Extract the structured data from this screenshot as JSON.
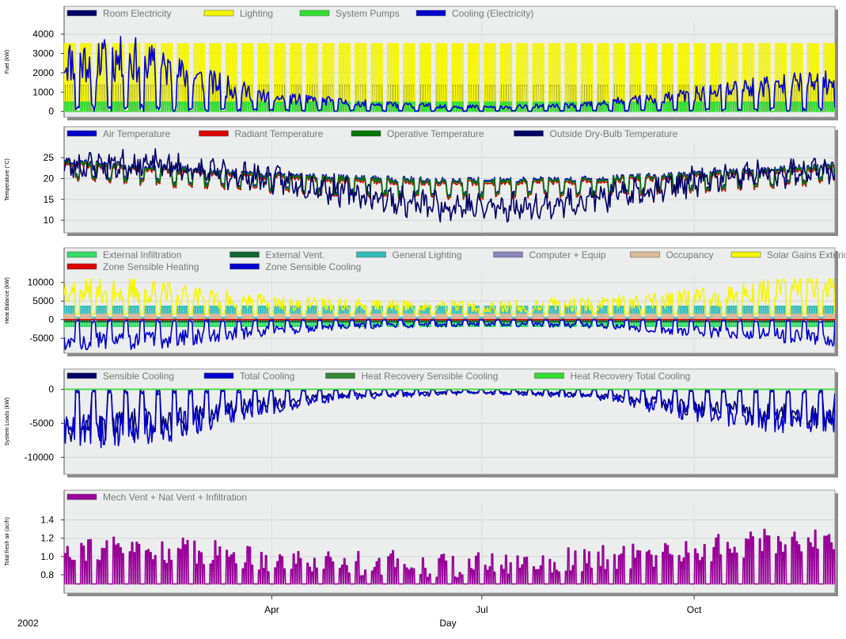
{
  "chart_data": {
    "type": "line",
    "year_label": "2002",
    "xlabel": "Day",
    "x_ticks": [
      "Apr",
      "Jul",
      "Oct"
    ],
    "x_tick_days": [
      90,
      181,
      273
    ],
    "x_range_days": [
      0,
      334
    ],
    "panels": [
      {
        "id": "fuel",
        "ylabel": "Fuel (kW)",
        "ylim": [
          -300,
          4700
        ],
        "yticks": [
          0,
          1000,
          2000,
          3000,
          4000
        ],
        "ytick_labels": [
          "0",
          "1000",
          "2000",
          "3000",
          "4000"
        ],
        "legend_rows": [
          [
            "Room Electricity",
            "Lighting",
            "System Pumps",
            "Cooling (Electricity)"
          ]
        ],
        "series": [
          {
            "name": "Room Electricity",
            "color": "#000066",
            "pattern": "square",
            "period": 7,
            "work": 5,
            "hi": 1350,
            "lo": 0
          },
          {
            "name": "Lighting",
            "color": "#f5f500",
            "pattern": "square",
            "period": 7,
            "work": 5,
            "hi": 3500,
            "lo": 0
          },
          {
            "name": "System Pumps",
            "color": "#33dd33",
            "pattern": "square",
            "period": 7,
            "work": 5,
            "hi": 480,
            "lo": 0
          },
          {
            "name": "Cooling (Electricity)",
            "color": "#0000cc",
            "pattern": "noisy",
            "seed": 11,
            "env": [
              [
                0,
                2600
              ],
              [
                30,
                2700
              ],
              [
                60,
                1600
              ],
              [
                90,
                700
              ],
              [
                140,
                350
              ],
              [
                181,
                220
              ],
              [
                220,
                300
              ],
              [
                260,
                700
              ],
              [
                300,
                1300
              ],
              [
                334,
                1500
              ]
            ],
            "min": 0,
            "max": 4300
          }
        ]
      },
      {
        "id": "temperature",
        "ylabel": "Temperature (°C)",
        "ylim": [
          7,
          29
        ],
        "yticks": [
          10,
          15,
          20,
          25
        ],
        "ytick_labels": [
          "10",
          "15",
          "20",
          "25"
        ],
        "legend_rows": [
          [
            "Air Temperature",
            "Radiant Temperature",
            "Operative Temperature",
            "Outside Dry-Bulb Temperature"
          ]
        ],
        "series": [
          {
            "name": "Air Temperature",
            "color": "#0000cc",
            "pattern": "comfort",
            "offset": 0.3
          },
          {
            "name": "Radiant Temperature",
            "color": "#dd0000",
            "pattern": "comfort",
            "offset": -0.4
          },
          {
            "name": "Operative Temperature",
            "color": "#007700",
            "pattern": "comfort",
            "offset": 0
          },
          {
            "name": "Outside Dry-Bulb Temperature",
            "color": "#000066",
            "pattern": "outdoor",
            "seed": 23,
            "env": [
              [
                0,
                23
              ],
              [
                40,
                23.5
              ],
              [
                60,
                21.5
              ],
              [
                90,
                20
              ],
              [
                120,
                17
              ],
              [
                150,
                14
              ],
              [
                181,
                13
              ],
              [
                210,
                13.5
              ],
              [
                240,
                16
              ],
              [
                270,
                19
              ],
              [
                300,
                21
              ],
              [
                334,
                22
              ]
            ],
            "min": 8.5,
            "max": 27.5
          }
        ]
      },
      {
        "id": "heat-balance",
        "ylabel": "Heat Balance (kW)",
        "ylim": [
          -9000,
          12500
        ],
        "yticks": [
          -5000,
          0,
          5000,
          10000
        ],
        "ytick_labels": [
          "-5000",
          "0",
          "5000",
          "10000"
        ],
        "legend_rows": [
          [
            "External Infiltration",
            "External Vent.",
            "General Lighting",
            "Computer + Equip",
            "Occupancy",
            "Solar Gains Exterior Windows"
          ],
          [
            "Zone Sensible Heating",
            "Zone Sensible Cooling"
          ]
        ],
        "series": [
          {
            "name": "External Infiltration",
            "color": "#33dd66",
            "pattern": "square",
            "period": 7,
            "work": 5,
            "hi": -1800,
            "lo": 200
          },
          {
            "name": "External Vent.",
            "color": "#116633",
            "pattern": "square",
            "period": 7,
            "work": 5,
            "hi": -600,
            "lo": 0
          },
          {
            "name": "General Lighting",
            "color": "#33bbbb",
            "pattern": "square",
            "period": 7,
            "work": 5,
            "hi": 3600,
            "lo": 600
          },
          {
            "name": "Computer + Equip",
            "color": "#8888bb",
            "pattern": "square",
            "period": 7,
            "work": 5,
            "hi": 900,
            "lo": 100
          },
          {
            "name": "Occupancy",
            "color": "#ddbb99",
            "pattern": "square",
            "period": 7,
            "work": 5,
            "hi": 1400,
            "lo": 0
          },
          {
            "name": "Solar Gains Exterior Windows",
            "color": "#f5f500",
            "pattern": "noisy",
            "seed": 37,
            "env": [
              [
                0,
                8500
              ],
              [
                30,
                8000
              ],
              [
                60,
                6000
              ],
              [
                100,
                4200
              ],
              [
                181,
                3500
              ],
              [
                240,
                4500
              ],
              [
                280,
                6000
              ],
              [
                334,
                9500
              ]
            ],
            "min": 1500,
            "max": 11000
          },
          {
            "name": "Zone Sensible Heating",
            "color": "#dd0000",
            "pattern": "flat",
            "value": 0
          },
          {
            "name": "Zone Sensible Cooling",
            "color": "#0000cc",
            "pattern": "noisy",
            "seed": 51,
            "env": [
              [
                0,
                -6000
              ],
              [
                40,
                -5500
              ],
              [
                80,
                -3500
              ],
              [
                120,
                -1800
              ],
              [
                181,
                -1200
              ],
              [
                230,
                -1600
              ],
              [
                270,
                -3000
              ],
              [
                334,
                -5000
              ]
            ],
            "min": -8000,
            "max": 0
          }
        ]
      },
      {
        "id": "system-loads",
        "ylabel": "System Loads (kW)",
        "ylim": [
          -12500,
          900
        ],
        "yticks": [
          -10000,
          -5000,
          0
        ],
        "ytick_labels": [
          "-10000",
          "-5000",
          "0"
        ],
        "legend_rows": [
          [
            "Sensible Cooling",
            "Total Cooling",
            "Heat Recovery Sensible Cooling",
            "Heat Recovery Total Cooling"
          ]
        ],
        "series": [
          {
            "name": "Sensible Cooling",
            "color": "#000066",
            "pattern": "noisy",
            "seed": 71,
            "env": [
              [
                0,
                -5500
              ],
              [
                40,
                -5000
              ],
              [
                80,
                -2500
              ],
              [
                120,
                -900
              ],
              [
                181,
                -400
              ],
              [
                230,
                -800
              ],
              [
                270,
                -2600
              ],
              [
                334,
                -4500
              ]
            ],
            "min": -11800,
            "max": 0
          },
          {
            "name": "Total Cooling",
            "color": "#0000cc",
            "pattern": "noisy",
            "seed": 72,
            "env": [
              [
                0,
                -6200
              ],
              [
                40,
                -5800
              ],
              [
                80,
                -3000
              ],
              [
                120,
                -1100
              ],
              [
                181,
                -500
              ],
              [
                230,
                -1000
              ],
              [
                270,
                -3200
              ],
              [
                334,
                -5200
              ]
            ],
            "min": -11800,
            "max": 0
          },
          {
            "name": "Heat Recovery Sensible Cooling",
            "color": "#338833",
            "pattern": "flat",
            "value": 0
          },
          {
            "name": "Heat Recovery Total Cooling",
            "color": "#33dd33",
            "pattern": "flat",
            "value": 0
          }
        ]
      },
      {
        "id": "fresh-air",
        "ylabel": "Total fresh air (ac/h)",
        "ylim": [
          0.6,
          1.57
        ],
        "yticks": [
          0.8,
          1.0,
          1.2,
          1.4
        ],
        "ytick_labels": [
          "0.8",
          "1.0",
          "1.2",
          "1.4"
        ],
        "legend_rows": [
          [
            "Mech Vent + Nat Vent + Infiltration"
          ]
        ],
        "series": [
          {
            "name": "Mech Vent + Nat Vent + Infiltration",
            "color": "#990099",
            "pattern": "freshair",
            "seed": 91,
            "base": 0.7,
            "env": [
              [
                0,
                1.1
              ],
              [
                60,
                1.05
              ],
              [
                100,
                0.95
              ],
              [
                181,
                0.9
              ],
              [
                250,
                1.0
              ],
              [
                300,
                1.15
              ],
              [
                334,
                1.2
              ]
            ],
            "min": 0.7,
            "max": 1.48
          }
        ]
      }
    ]
  }
}
